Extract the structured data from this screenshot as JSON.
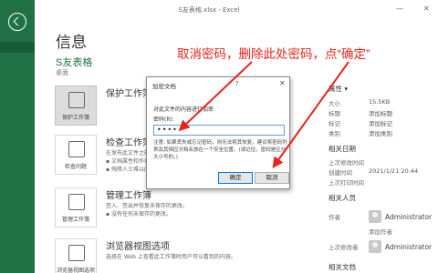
{
  "window": {
    "title": "S友表格.xlsx - Excel",
    "minimize": "—",
    "close": "✕"
  },
  "info": {
    "heading": "信息",
    "file_name": "S友表格",
    "location": "桌面"
  },
  "sections": [
    {
      "title": "保护工作簿",
      "tile_label": "保护工作簿",
      "desc": "",
      "icon": "lock-icon"
    },
    {
      "title": "检查工作簿",
      "tile_label": "检查问题",
      "desc": "在发布此文件之前，请注意其是否包含：\n▪ 文档属性和作者的姓名\n▪ 残障人士难以阅读的内容",
      "icon": "inspect-icon"
    },
    {
      "title": "管理工作簿",
      "tile_label": "管理工作簿",
      "desc": "签入、签出并恢复未保存的更改。\n▪ 没有任何未保存的更改。",
      "icon": "manage-icon"
    },
    {
      "title": "浏览器视图选项",
      "tile_label": "浏览器视图选项",
      "desc": "选择在 Web 上查看此工作簿时用户可以看到的内容。",
      "icon": "browser-icon"
    }
  ],
  "properties": {
    "heading": "属性 ▾",
    "rows": [
      {
        "key": "大小",
        "value": "15.5KB"
      },
      {
        "key": "标题",
        "value": "添加标题"
      },
      {
        "key": "标记",
        "value": "添加标记"
      },
      {
        "key": "类别",
        "value": "添加类别"
      }
    ],
    "dates_heading": "相关日期",
    "dates": [
      {
        "key": "上次修改时间",
        "value": ""
      },
      {
        "key": "创建时间",
        "value": "2021/1/21 20:44"
      },
      {
        "key": "上次打印时间",
        "value": ""
      }
    ],
    "people_heading": "相关人员",
    "author_label": "作者",
    "author_name": "Administrator",
    "author_add": "添加作者",
    "modified_label": "上次修改者",
    "modified_name": "Administrator",
    "docs_heading": "相关文档"
  },
  "dialog": {
    "title": "加密文档",
    "help": "?",
    "close": "✕",
    "caption": "对此文件的内容进行加密",
    "password_label": "密码(R):",
    "password_value": "••••",
    "warning": "注意: 如果丢失或忘记密码，则无法将其恢复。建议将密码列表及其相应文档名放在一个安全位置。(请记住，密码是区分大小写的。)",
    "ok": "确定",
    "cancel": "取消"
  },
  "annotation": {
    "text": "取消密码，删除此处密码，点“确定”",
    "color": "#e8231b"
  },
  "colors": {
    "sidebar": "#207245",
    "accent": "#207245"
  }
}
